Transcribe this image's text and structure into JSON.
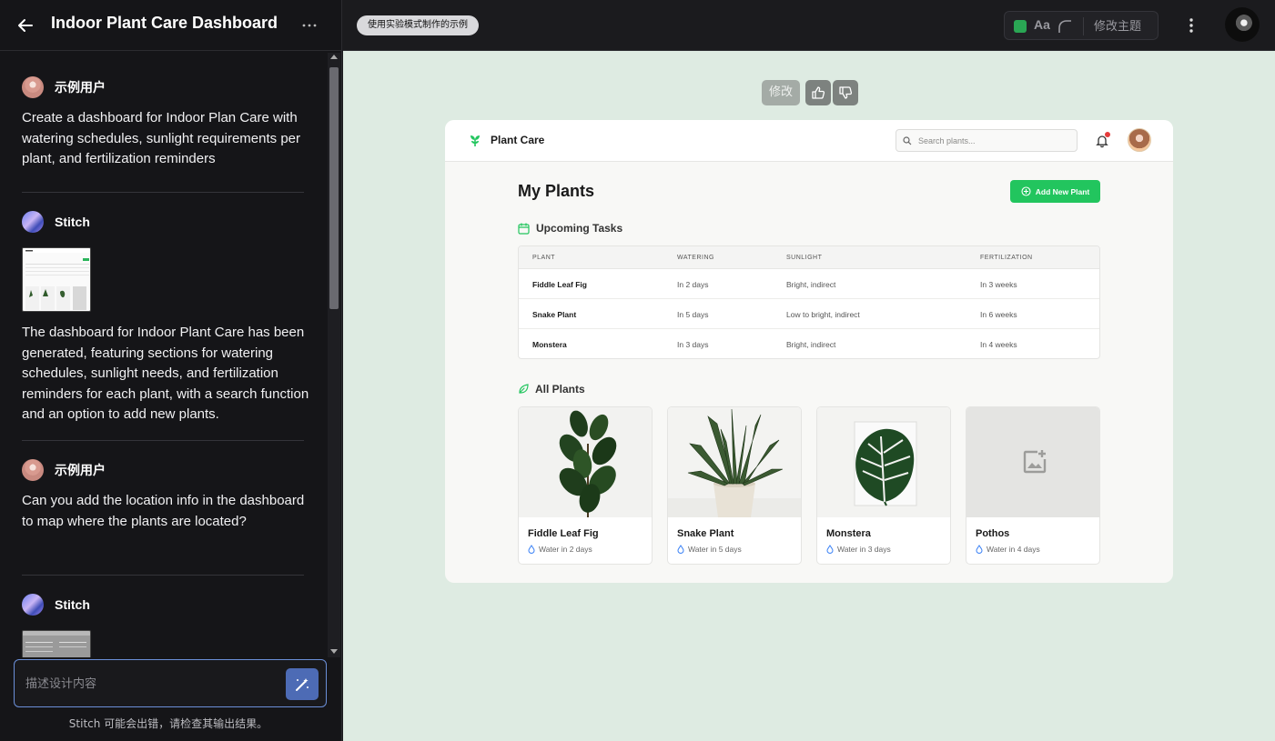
{
  "project": {
    "title": "Indoor Plant Care Dashboard"
  },
  "chat": {
    "messages": [
      {
        "author": "示例用户",
        "text": "Create a dashboard for Indoor Plan Care with watering schedules, sunlight requirements per plant, and fertilization reminders"
      },
      {
        "author": "Stitch",
        "text": "The dashboard for Indoor Plant Care has been generated, featuring sections for watering schedules, sunlight needs, and fertilization reminders for each plant, with a search function and an option to add new plants."
      },
      {
        "author": "示例用户",
        "text": "Can you add the location info in the dashboard to map where the plants are located?"
      },
      {
        "author": "Stitch",
        "text": ""
      }
    ]
  },
  "prompt": {
    "placeholder": "描述设计内容",
    "value": ""
  },
  "disclaimer": "Stitch 可能会出错，请检查其输出结果。",
  "top_bar": {
    "experimental_badge": "使用实验模式制作的示例",
    "theme_font_label": "Aa",
    "theme_edit_label": "修改主题",
    "theme_color": "#2aa654"
  },
  "canvas": {
    "revise_label": "修改",
    "background": "#deebe2"
  },
  "preview": {
    "brand": "Plant Care",
    "search_placeholder": "Search plants...",
    "page_title": "My Plants",
    "add_button_label": "Add New Plant",
    "accent_color": "#22c55e",
    "tasks_heading": "Upcoming Tasks",
    "table": {
      "columns": [
        "PLANT",
        "WATERING",
        "SUNLIGHT",
        "FERTILIZATION"
      ],
      "rows": [
        {
          "plant": "Fiddle Leaf Fig",
          "watering": "In 2 days",
          "sunlight": "Bright, indirect",
          "fertilization": "In 3 weeks"
        },
        {
          "plant": "Snake Plant",
          "watering": "In 5 days",
          "sunlight": "Low to bright, indirect",
          "fertilization": "In 6 weeks"
        },
        {
          "plant": "Monstera",
          "watering": "In 3 days",
          "sunlight": "Bright, indirect",
          "fertilization": "In 4 weeks"
        }
      ]
    },
    "plants_heading": "All Plants",
    "plants": [
      {
        "name": "Fiddle Leaf Fig",
        "water": "Water in 2 days",
        "image": "fiddle-leaf-fig-photo"
      },
      {
        "name": "Snake Plant",
        "water": "Water in 5 days",
        "image": "snake-plant-photo"
      },
      {
        "name": "Monstera",
        "water": "Water in 3 days",
        "image": "monstera-photo"
      },
      {
        "name": "Pothos",
        "water": "Water in 4 days",
        "image": "image-placeholder-icon"
      }
    ]
  }
}
